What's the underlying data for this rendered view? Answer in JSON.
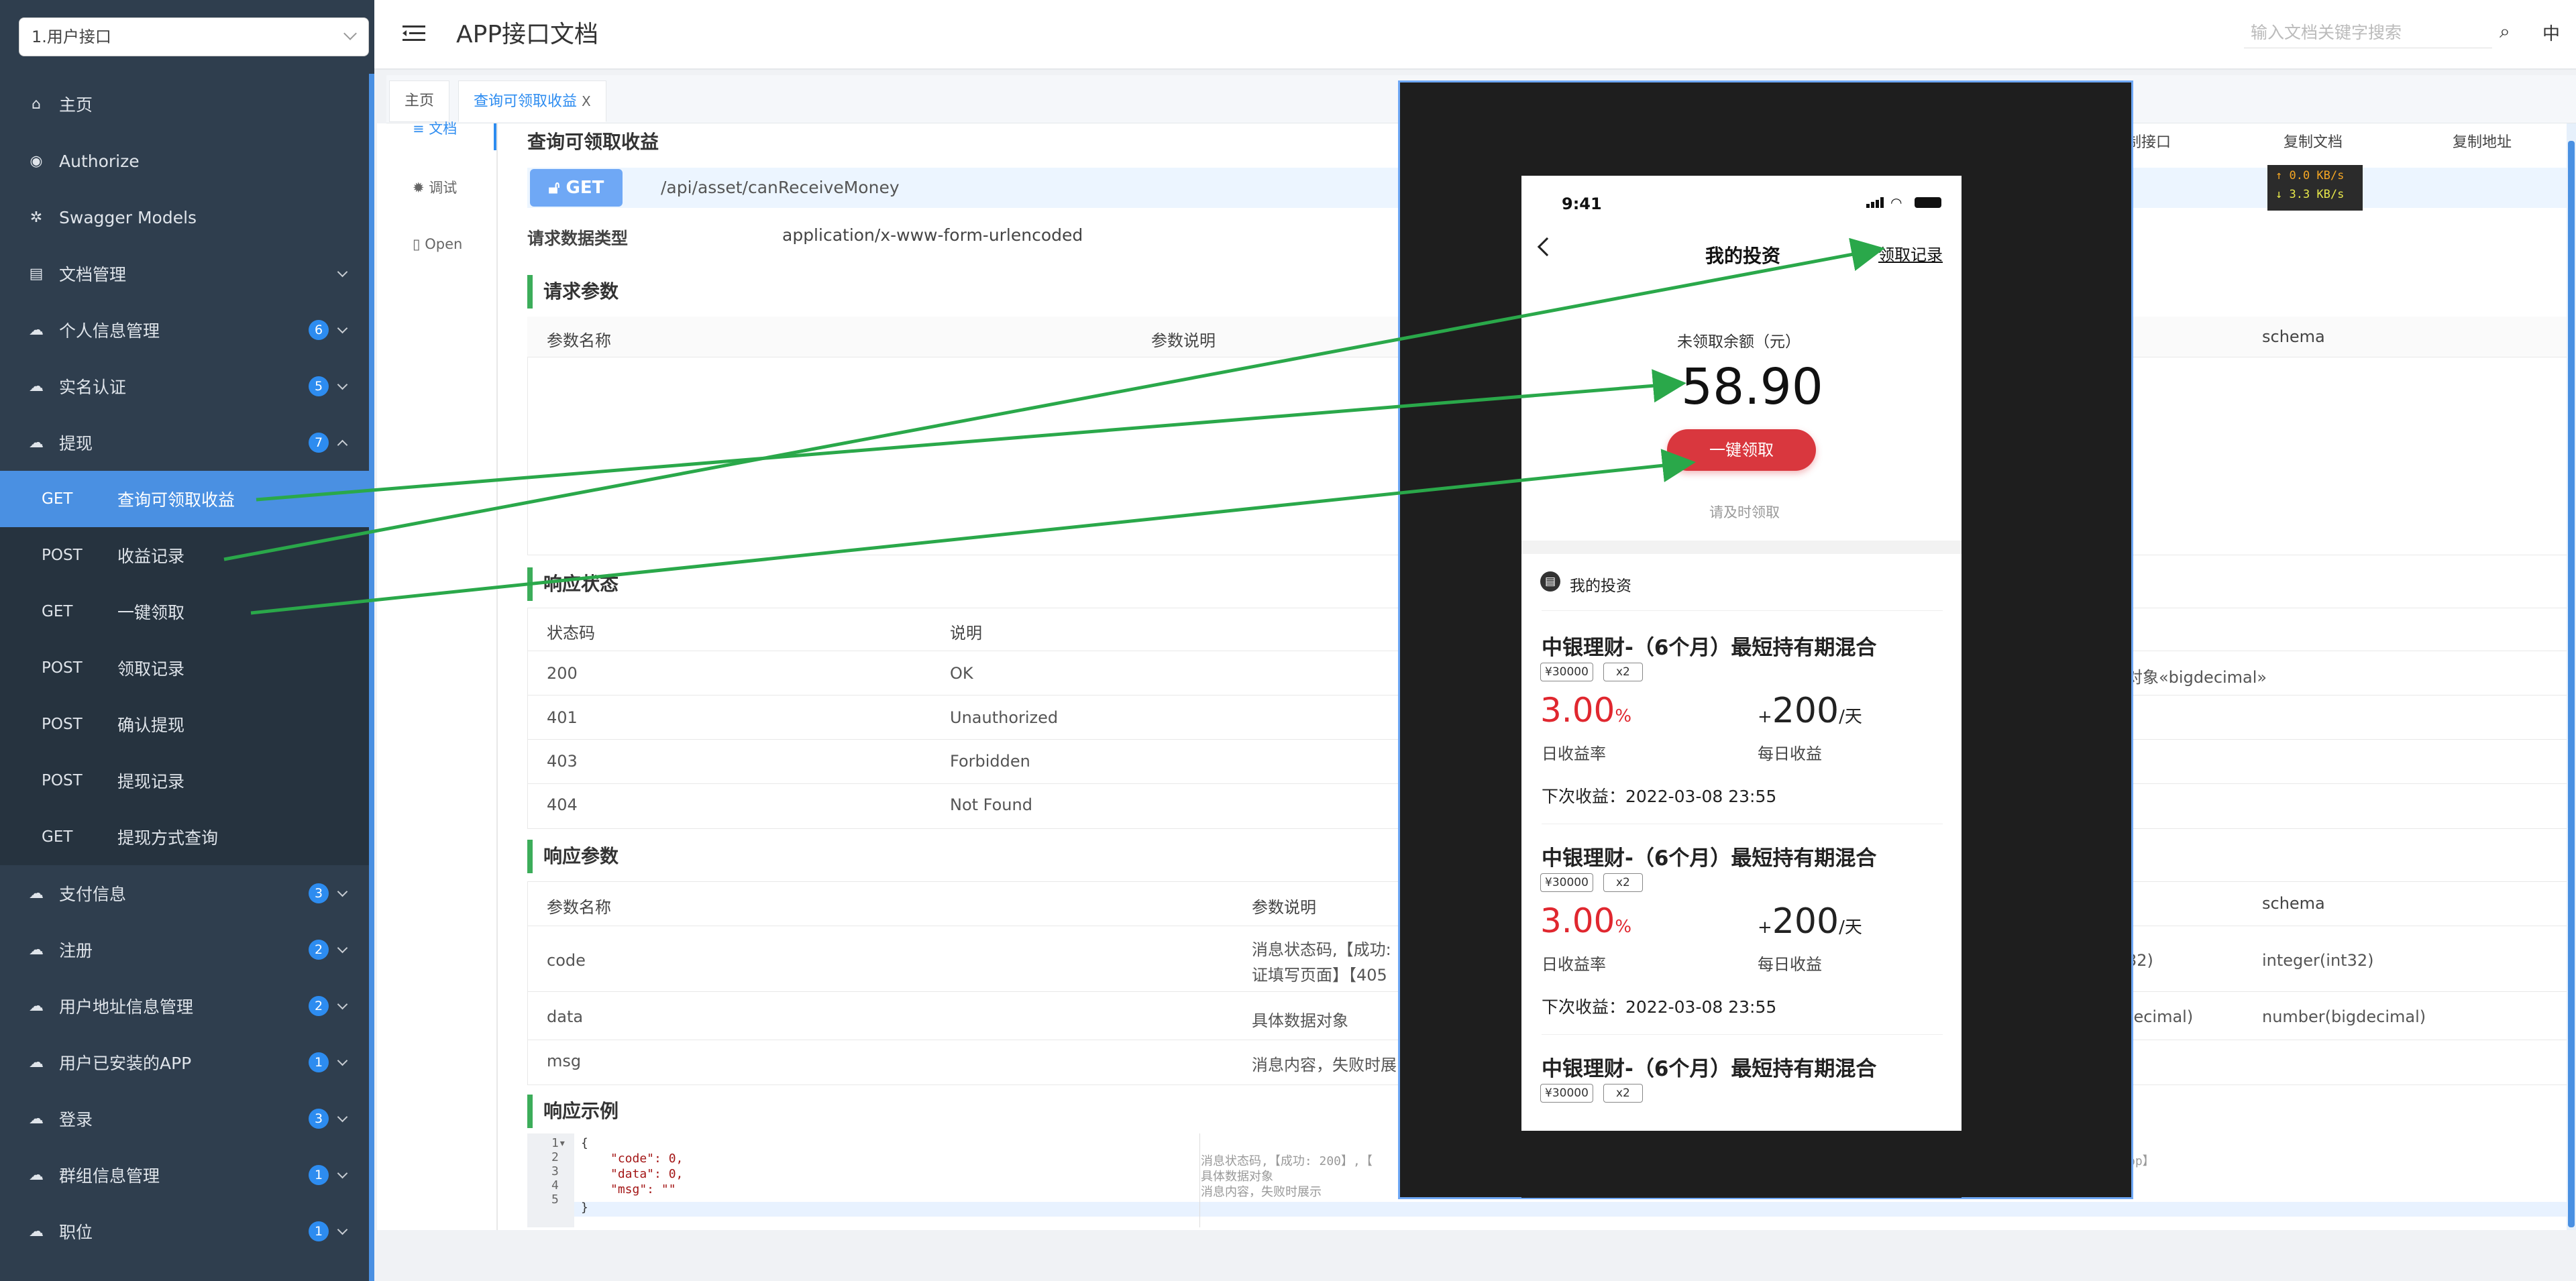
{
  "sidebar": {
    "project_select": "1.用户接口",
    "items": [
      {
        "label": "主页",
        "icon": "home-icon"
      },
      {
        "label": "Authorize",
        "icon": "authorize-icon"
      },
      {
        "label": "Swagger Models",
        "icon": "models-icon"
      },
      {
        "label": "文档管理",
        "icon": "doc-manage-icon"
      },
      {
        "label": "个人信息管理",
        "icon": "cloud-icon",
        "badge": "6"
      },
      {
        "label": "实名认证",
        "icon": "cloud-icon",
        "badge": "5"
      },
      {
        "label": "提现",
        "icon": "cloud-icon",
        "badge": "7"
      },
      {
        "label": "支付信息",
        "icon": "cloud-icon",
        "badge": "3"
      },
      {
        "label": "注册",
        "icon": "cloud-icon",
        "badge": "2"
      },
      {
        "label": "用户地址信息管理",
        "icon": "cloud-icon",
        "badge": "2"
      },
      {
        "label": "用户已安装的APP",
        "icon": "cloud-icon",
        "badge": "1"
      },
      {
        "label": "登录",
        "icon": "cloud-icon",
        "badge": "3"
      },
      {
        "label": "群组信息管理",
        "icon": "cloud-icon",
        "badge": "1"
      },
      {
        "label": "职位",
        "icon": "cloud-icon",
        "badge": "1"
      }
    ],
    "withdraw_children": [
      {
        "method": "GET",
        "label": "查询可领取收益",
        "active": true
      },
      {
        "method": "POST",
        "label": "收益记录"
      },
      {
        "method": "GET",
        "label": "一键领取"
      },
      {
        "method": "POST",
        "label": "领取记录"
      },
      {
        "method": "POST",
        "label": "确认提现"
      },
      {
        "method": "POST",
        "label": "提现记录"
      },
      {
        "method": "GET",
        "label": "提现方式查询"
      }
    ]
  },
  "header": {
    "title": "APP接口文档",
    "search_placeholder": "输入文档关键字搜索",
    "lang": "中"
  },
  "tabs": [
    {
      "label": "主页"
    },
    {
      "label": "查询可领取收益",
      "close": "X",
      "active": true
    }
  ],
  "doc_nav": {
    "doc": "文档",
    "debug": "调试",
    "open": "Open"
  },
  "api": {
    "name": "查询可领取收益",
    "method": "GET",
    "path": "/api/asset/canReceiveMoney",
    "content_type_label": "请求数据类型",
    "content_type": "application/x-www-form-urlencoded",
    "copy_api": "制接口",
    "copy_doc": "复制文档",
    "copy_addr": "复制地址"
  },
  "request_params": {
    "section": "请求参数",
    "columns": [
      "参数名称",
      "参数说明",
      "schema"
    ]
  },
  "response_status": {
    "section": "响应状态",
    "columns": [
      "状态码",
      "说明"
    ],
    "rows": [
      {
        "code": "200",
        "desc": "OK",
        "extra": "对象«bigdecimal»"
      },
      {
        "code": "401",
        "desc": "Unauthorized"
      },
      {
        "code": "403",
        "desc": "Forbidden"
      },
      {
        "code": "404",
        "desc": "Not Found"
      }
    ]
  },
  "response_params": {
    "section": "响应参数",
    "columns": [
      "参数名称",
      "参数说明",
      "schema"
    ],
    "rows": [
      {
        "name": "code",
        "desc1": "消息状态码,【成功:",
        "desc2": "证填写页面】【405",
        "type": "32)",
        "schema": "integer(int32)"
      },
      {
        "name": "data",
        "desc1": "具体数据对象",
        "type": "gdecimal)",
        "schema": "number(bigdecimal)"
      },
      {
        "name": "msg",
        "desc1": "消息内容，失败时展"
      }
    ]
  },
  "response_example": {
    "section": "响应示例",
    "lines": [
      "{",
      "\"code\": 0,",
      "\"data\": 0,",
      "\"msg\": \"\"",
      "}"
    ],
    "comments": [
      "消息状态码,【成功: 200】,【",
      "具体数据对象",
      "消息内容，失败时展示"
    ],
    "tail_comment": "pp】"
  },
  "net_speed": {
    "up": "↑ 0.0 KB/s",
    "down": "↓ 3.3 KB/s",
    "up_color": "#f5a623",
    "down_color": "#e8e84a"
  },
  "phone": {
    "time": "9:41",
    "title": "我的投资",
    "record_link": "领取记录",
    "balance_label": "未领取余额（元）",
    "balance": "58.90",
    "collect_button": "一键领取",
    "hint": "请及时领取",
    "section": "我的投资",
    "investments": [
      {
        "name": "中银理财-（6个月）最短持有期混合",
        "tag1": "¥30000",
        "tag2": "x2",
        "rate": "3.00",
        "rate_unit": "%",
        "daily_prefix": "+",
        "daily": "200",
        "daily_unit": "/天",
        "rate_label": "日收益率",
        "daily_label": "每日收益",
        "next": "下次收益：2022-03-08 23:55"
      },
      {
        "name": "中银理财-（6个月）最短持有期混合",
        "tag1": "¥30000",
        "tag2": "x2",
        "rate": "3.00",
        "rate_unit": "%",
        "daily_prefix": "+",
        "daily": "200",
        "daily_unit": "/天",
        "rate_label": "日收益率",
        "daily_label": "每日收益",
        "next": "下次收益：2022-03-08 23:55"
      },
      {
        "name": "中银理财-（6个月）最短持有期混合",
        "tag1": "¥30000",
        "tag2": "x2"
      }
    ]
  },
  "colors": {
    "accent": "#4a90e2",
    "sidebar_bg": "#2f3e4e",
    "section_bar": "#3cad5a",
    "annotation_arrow": "#2aa84a",
    "phone_red": "#d9373e"
  }
}
